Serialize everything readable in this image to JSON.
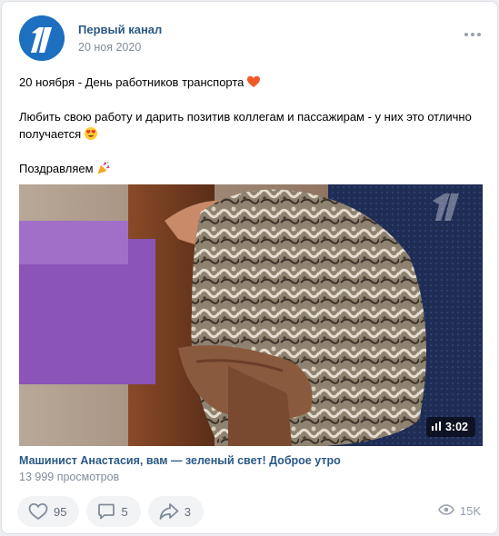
{
  "post": {
    "author": "Первый канал",
    "date": "20 ноя 2020",
    "text": {
      "line1": "20 ноября - День работников транспорта",
      "line2": "Любить свою работу и дарить позитив коллегам и пассажирам - у них это отлично получается",
      "line3": "Поздравляем"
    }
  },
  "video": {
    "duration": "3:02",
    "title": "Машинист Анастасия, вам — зеленый свет! Доброе утро",
    "views": "13 999 просмотров"
  },
  "actions": {
    "likes": "95",
    "comments": "5",
    "shares": "3",
    "views": "15K"
  },
  "colors": {
    "link": "#2a5885",
    "secondary": "#818c99",
    "button_bg": "#f2f3f5"
  },
  "icons": [
    "more-icon",
    "heart-icon",
    "comment-icon",
    "share-icon",
    "eye-icon",
    "heart-emoji-icon",
    "heart-eyes-emoji-icon",
    "party-popper-emoji-icon",
    "bars-icon"
  ]
}
